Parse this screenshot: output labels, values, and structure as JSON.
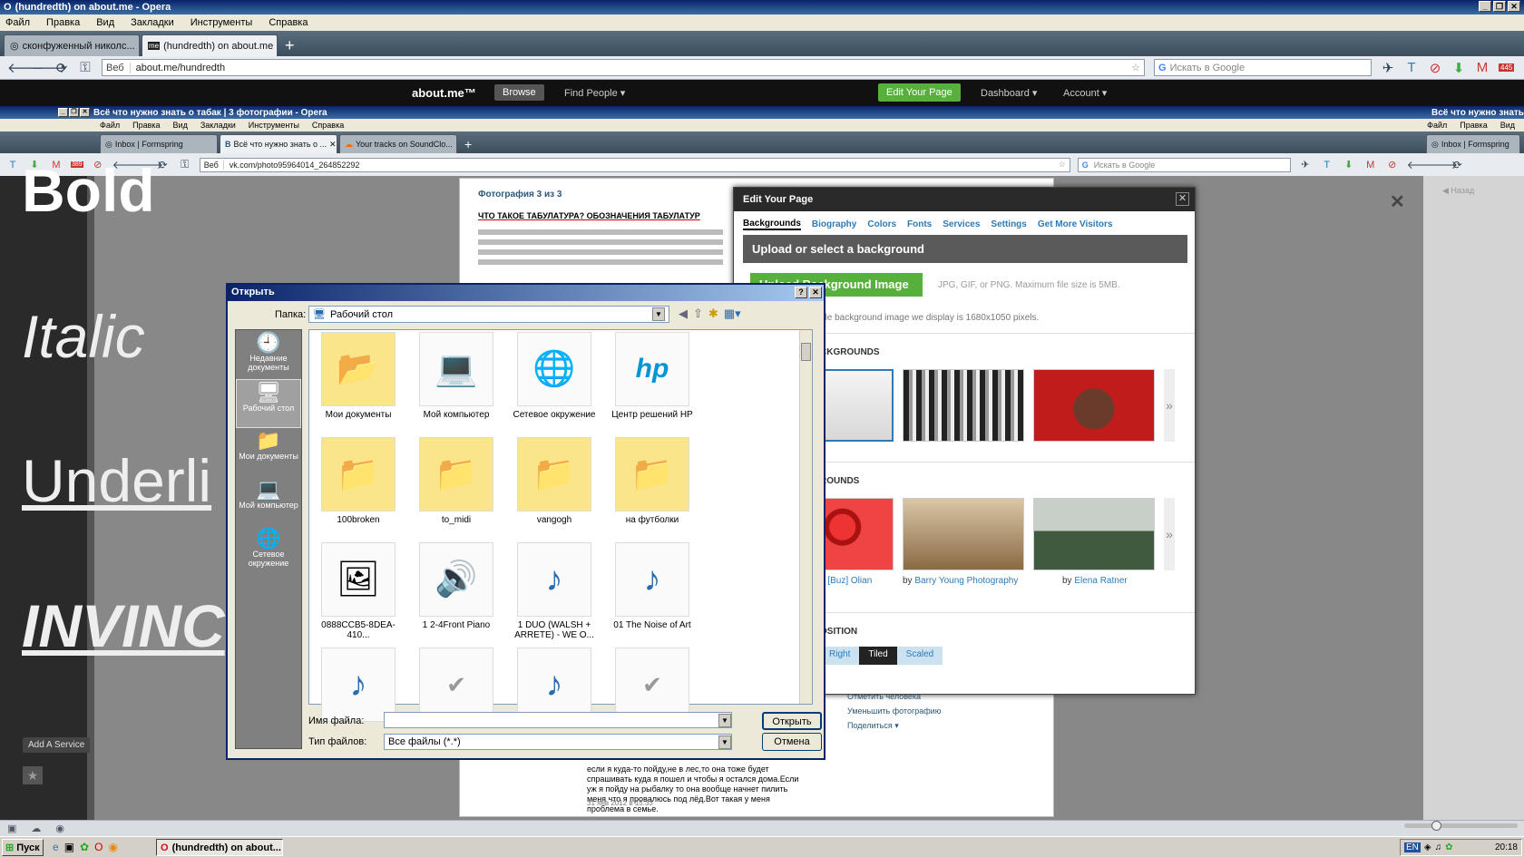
{
  "outer": {
    "title": "(hundredth) on about.me - Opera",
    "menu": [
      "Файл",
      "Правка",
      "Вид",
      "Закладки",
      "Инструменты",
      "Справка"
    ],
    "tabs": [
      {
        "label": "сконфуженный николс...",
        "active": false
      },
      {
        "label": "(hundredth) on about.me",
        "active": true
      }
    ],
    "web_label": "Веб",
    "url": "about.me/hundredth",
    "search_placeholder": "Искать в Google",
    "mail_count": "445"
  },
  "aboutme": {
    "logo": "about.me™",
    "browse": "Browse",
    "find_people": "Find People ▾",
    "edit_page": "Edit Your Page",
    "dashboard": "Dashboard ▾",
    "account": "Account ▾"
  },
  "inner": {
    "title": "Всё что нужно знать о табак | 3 фотографии - Opera",
    "title_right": "Всё что нужно знать",
    "menu": [
      "Файл",
      "Правка",
      "Вид",
      "Закладки",
      "Инструменты",
      "Справка"
    ],
    "menu_right": [
      "Файл",
      "Правка",
      "Вид"
    ],
    "tabs": [
      {
        "label": "Inbox | Formspring",
        "active": false
      },
      {
        "label": "Всё что нужно знать о ...",
        "active": true
      },
      {
        "label": "Your tracks on SoundClo...",
        "active": false
      }
    ],
    "tab_right": "Inbox | Formspring",
    "web_label": "Веб",
    "url": "vk.com/photo95964014_264852292",
    "search_placeholder": "Искать в Google",
    "mail_count": "389"
  },
  "fonts_preview": {
    "bold": "Bold",
    "italic": "Italic",
    "underline": "Underli",
    "invinc": "INVINC",
    "add_service": "Add A Service"
  },
  "vk": {
    "heading": "Фотография 3 из 3",
    "article_title": "ЧТО ТАКОЕ ТАБУЛАТУРА? ОБОЗНАЧЕНИЯ ТАБУЛАТУР",
    "actions": [
      "Отметить человека",
      "Уменьшить фотографию",
      "Поделиться ▾"
    ],
    "comment": "если я куда-то пойду,не в лес,то она тоже будет спрашивать куда я пошел и чтобы я остался дома.Если уж я пойду на рыбалку то она вообще начнет пилить меня что я провалюсь под лёд.Вот такая у меня проблема в семье.",
    "date": "31 янв 2012 в 15:33",
    "back": "Назад"
  },
  "edit_panel": {
    "title": "Edit Your Page",
    "tabs": [
      "Backgrounds",
      "Biography",
      "Colors",
      "Fonts",
      "Services",
      "Settings",
      "Get More Visitors"
    ],
    "upload_heading": "Upload or select a background",
    "upload_button": "Upload Background Image",
    "note": "JPG, GIF, or PNG. Maximum file size is 5MB.",
    "note2": "ble background image we display is 1680x1050 pixels.",
    "section1": "CKGROUNDS",
    "section2": "ROUNDS",
    "captions": [
      {
        "by": "",
        "name": "n [Buz] Olian"
      },
      {
        "by": "by ",
        "name": "Barry Young Photography"
      },
      {
        "by": "by ",
        "name": "Elena Ratner"
      }
    ],
    "section3": "OSITION",
    "positions": [
      {
        "label": "Right",
        "active": false
      },
      {
        "label": "Tiled",
        "active": true
      },
      {
        "label": "Scaled",
        "active": false
      }
    ]
  },
  "dialog": {
    "title": "Открыть",
    "lookin_label": "Папка:",
    "lookin_value": "Рабочий стол",
    "places": [
      {
        "label": "Недавние документы",
        "icon": "recent-icon",
        "glyph": "🕘",
        "selected": false
      },
      {
        "label": "Рабочий стол",
        "icon": "desktop-icon",
        "glyph": "🖥",
        "selected": true
      },
      {
        "label": "Мои документы",
        "icon": "my-documents-icon",
        "glyph": "📁",
        "selected": false
      },
      {
        "label": "Мой компьютер",
        "icon": "my-computer-icon",
        "glyph": "💻",
        "selected": false
      },
      {
        "label": "Сетевое окружение",
        "icon": "network-icon",
        "glyph": "🌐",
        "selected": false
      }
    ],
    "files": [
      {
        "name": "Мои документы",
        "icon": "folder-docs-icon",
        "glyph": "📂",
        "folder": true
      },
      {
        "name": "Мой компьютер",
        "icon": "computer-icon",
        "glyph": "💻",
        "folder": false
      },
      {
        "name": "Сетевое окружение",
        "icon": "network-icon",
        "glyph": "🌐",
        "folder": false
      },
      {
        "name": "Центр решений HP",
        "icon": "hp-icon",
        "glyph": "hp",
        "folder": false
      },
      {
        "name": "100broken",
        "icon": "folder-icon",
        "glyph": "📁",
        "folder": true
      },
      {
        "name": "to_midi",
        "icon": "folder-icon",
        "glyph": "📁",
        "folder": true
      },
      {
        "name": "vangogh",
        "icon": "folder-icon",
        "glyph": "📁",
        "folder": true
      },
      {
        "name": "на футболки",
        "icon": "folder-icon",
        "glyph": "📁",
        "folder": true
      },
      {
        "name": "0888CCB5-8DEA-410...",
        "icon": "image-file-icon",
        "glyph": "🖼",
        "folder": false
      },
      {
        "name": "1 2-4Front Piano",
        "icon": "audio-file-icon",
        "glyph": "🔊",
        "folder": false
      },
      {
        "name": "1 DUO (WALSH + ARRETE) - WE O...",
        "icon": "mp3-icon",
        "glyph": "♪",
        "folder": false
      },
      {
        "name": "01 The Noise of Art",
        "icon": "mp3-icon",
        "glyph": "♪",
        "folder": false
      },
      {
        "name": "",
        "icon": "mp3-icon",
        "glyph": "♪",
        "folder": false
      },
      {
        "name": "",
        "icon": "file-icon",
        "glyph": "✔",
        "folder": false
      },
      {
        "name": "",
        "icon": "mp3-icon",
        "glyph": "♪",
        "folder": false
      },
      {
        "name": "",
        "icon": "file-icon",
        "glyph": "✔",
        "folder": false
      }
    ],
    "filename_label": "Имя файла:",
    "filename_value": "",
    "filetype_label": "Тип файлов:",
    "filetype_value": "Все файлы (*.*)",
    "open_button": "Открыть",
    "cancel_button": "Отмена"
  },
  "taskbar": {
    "start": "Пуск",
    "task": "(hundredth) on about...",
    "lang": "EN",
    "clock": "20:18"
  }
}
